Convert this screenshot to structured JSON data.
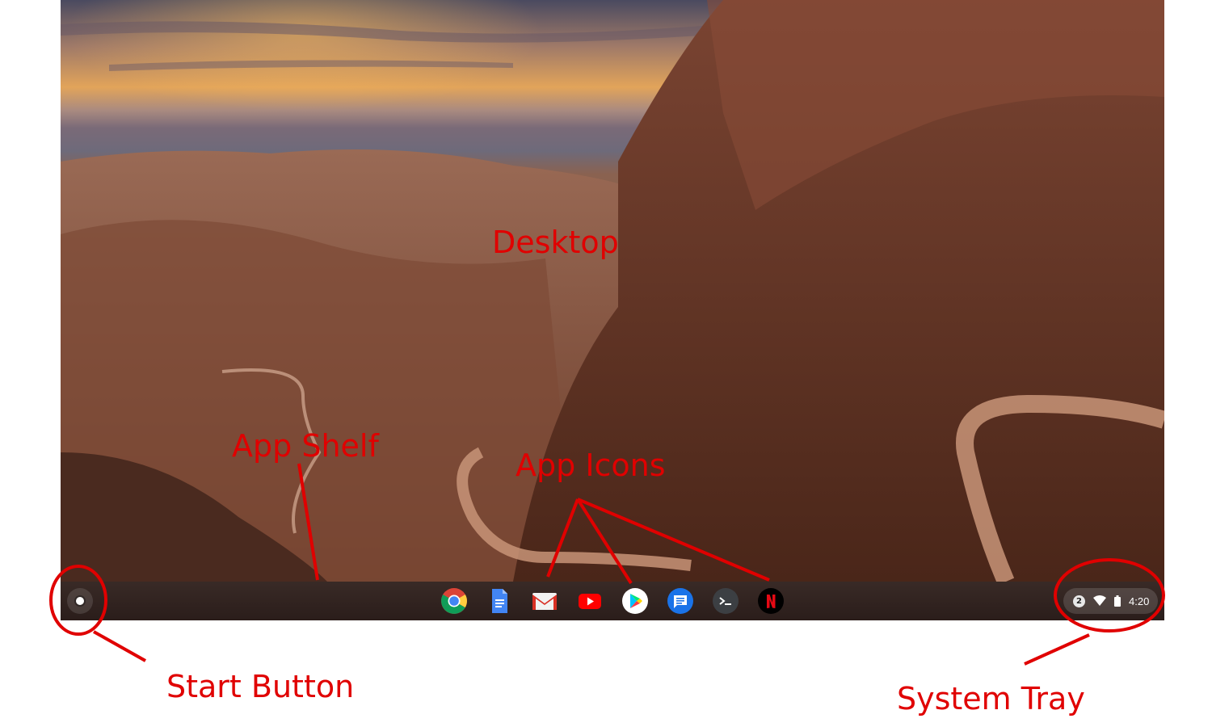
{
  "desktop": {
    "wallpaper": "canyon-road-landscape"
  },
  "shelf": {
    "launcher_icon": "launcher-circle-icon",
    "apps": [
      {
        "name": "chrome",
        "icon": "chrome-icon"
      },
      {
        "name": "docs",
        "icon": "docs-icon"
      },
      {
        "name": "gmail",
        "icon": "gmail-icon"
      },
      {
        "name": "youtube",
        "icon": "youtube-icon"
      },
      {
        "name": "play-store",
        "icon": "play-store-icon"
      },
      {
        "name": "messages",
        "icon": "messages-icon"
      },
      {
        "name": "terminal",
        "icon": "terminal-icon"
      },
      {
        "name": "netflix",
        "icon": "netflix-icon"
      }
    ]
  },
  "tray": {
    "notification_count": "2",
    "time": "4:20"
  },
  "annotations": {
    "desktop": "Desktop",
    "app_shelf": "App Shelf",
    "app_icons": "App Icons",
    "start_button": "Start Button",
    "system_tray": "System Tray"
  },
  "colors": {
    "annotation": "#e00000",
    "shelf": "#2a1914"
  }
}
